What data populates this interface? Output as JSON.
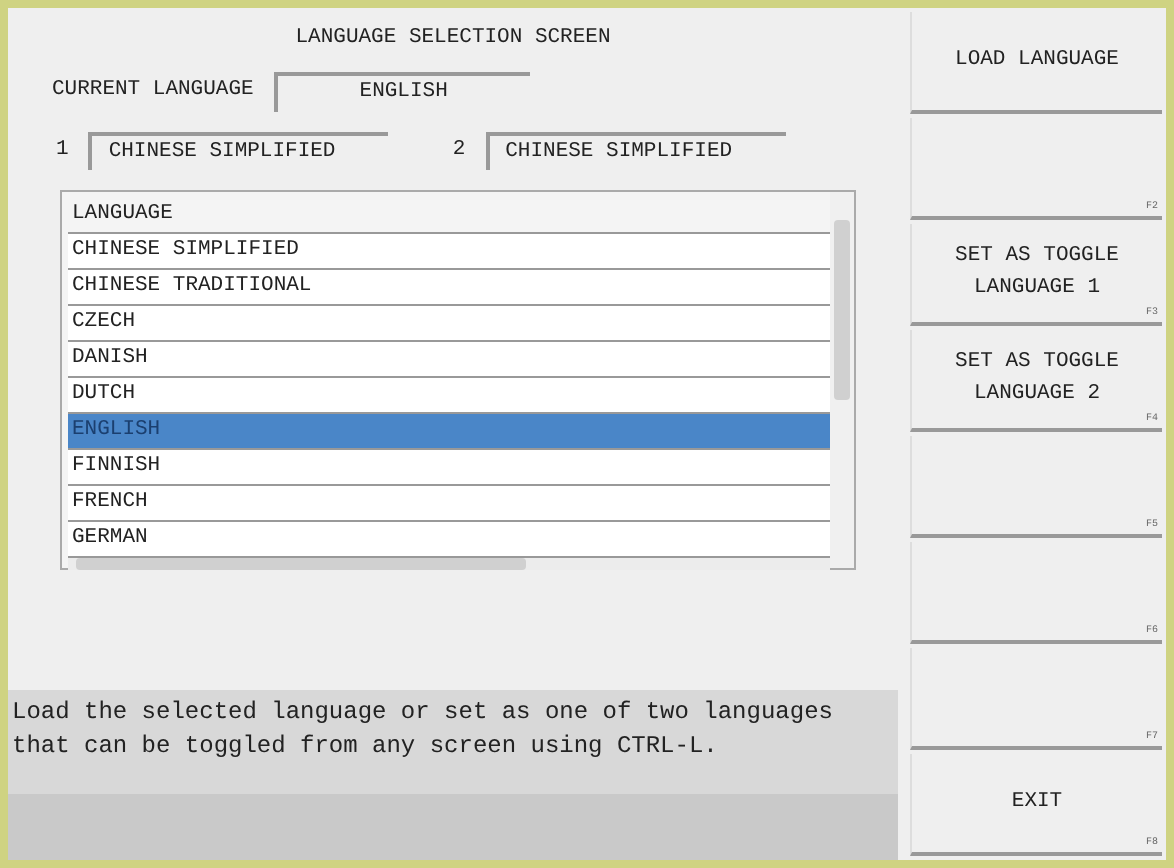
{
  "screen_title": "LANGUAGE SELECTION SCREEN",
  "current_language": {
    "label": "CURRENT LANGUAGE",
    "value": "ENGLISH"
  },
  "toggle_languages": [
    {
      "number": "1",
      "value": "CHINESE SIMPLIFIED"
    },
    {
      "number": "2",
      "value": "CHINESE SIMPLIFIED"
    }
  ],
  "language_list": {
    "header": "LANGUAGE",
    "rows": [
      {
        "name": "CHINESE SIMPLIFIED",
        "selected": false
      },
      {
        "name": "CHINESE TRADITIONAL",
        "selected": false
      },
      {
        "name": "CZECH",
        "selected": false
      },
      {
        "name": "DANISH",
        "selected": false
      },
      {
        "name": "DUTCH",
        "selected": false
      },
      {
        "name": "ENGLISH",
        "selected": true
      },
      {
        "name": "FINNISH",
        "selected": false
      },
      {
        "name": "FRENCH",
        "selected": false
      },
      {
        "name": "GERMAN",
        "selected": false
      }
    ]
  },
  "message": "Load the selected language or set as one of two languages that can be toggled from any screen using CTRL-L.",
  "function_keys": [
    {
      "label": "LOAD LANGUAGE"
    },
    {
      "key": "F2"
    },
    {
      "label": "SET AS TOGGLE LANGUAGE 1",
      "key": "F3"
    },
    {
      "label": "SET AS TOGGLE LANGUAGE 2",
      "key": "F4"
    },
    {
      "key": "F5"
    },
    {
      "key": "F6"
    },
    {
      "key": "F7"
    },
    {
      "label": "EXIT",
      "key": "F8"
    }
  ]
}
